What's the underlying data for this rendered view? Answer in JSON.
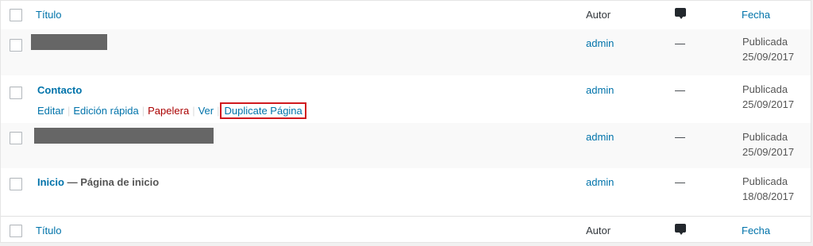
{
  "header": {
    "title_col": "Título",
    "author_col": "Autor",
    "comments_icon": "comment-bubble-icon",
    "date_col": "Fecha"
  },
  "rows": [
    {
      "title": "",
      "title_redacted": true,
      "author": "admin",
      "comments": "—",
      "status": "Publicada",
      "date": "25/09/2017"
    },
    {
      "title": "Contacto",
      "author": "admin",
      "comments": "—",
      "status": "Publicada",
      "date": "25/09/2017",
      "row_actions": {
        "edit": "Editar",
        "quick_edit": "Edición rápida",
        "trash": "Papelera",
        "view": "Ver",
        "duplicate": "Duplicate Página",
        "separator": "|"
      }
    },
    {
      "title": "",
      "title_redacted": true,
      "author": "admin",
      "comments": "—",
      "status": "Publicada",
      "date": "25/09/2017"
    },
    {
      "title": "Inicio",
      "post_state": "— Página de inicio",
      "author": "admin",
      "comments": "—",
      "status": "Publicada",
      "date": "18/08/2017"
    }
  ],
  "colors": {
    "link": "#0073aa",
    "trash": "#aa0000",
    "highlight_border": "#d0191e"
  }
}
